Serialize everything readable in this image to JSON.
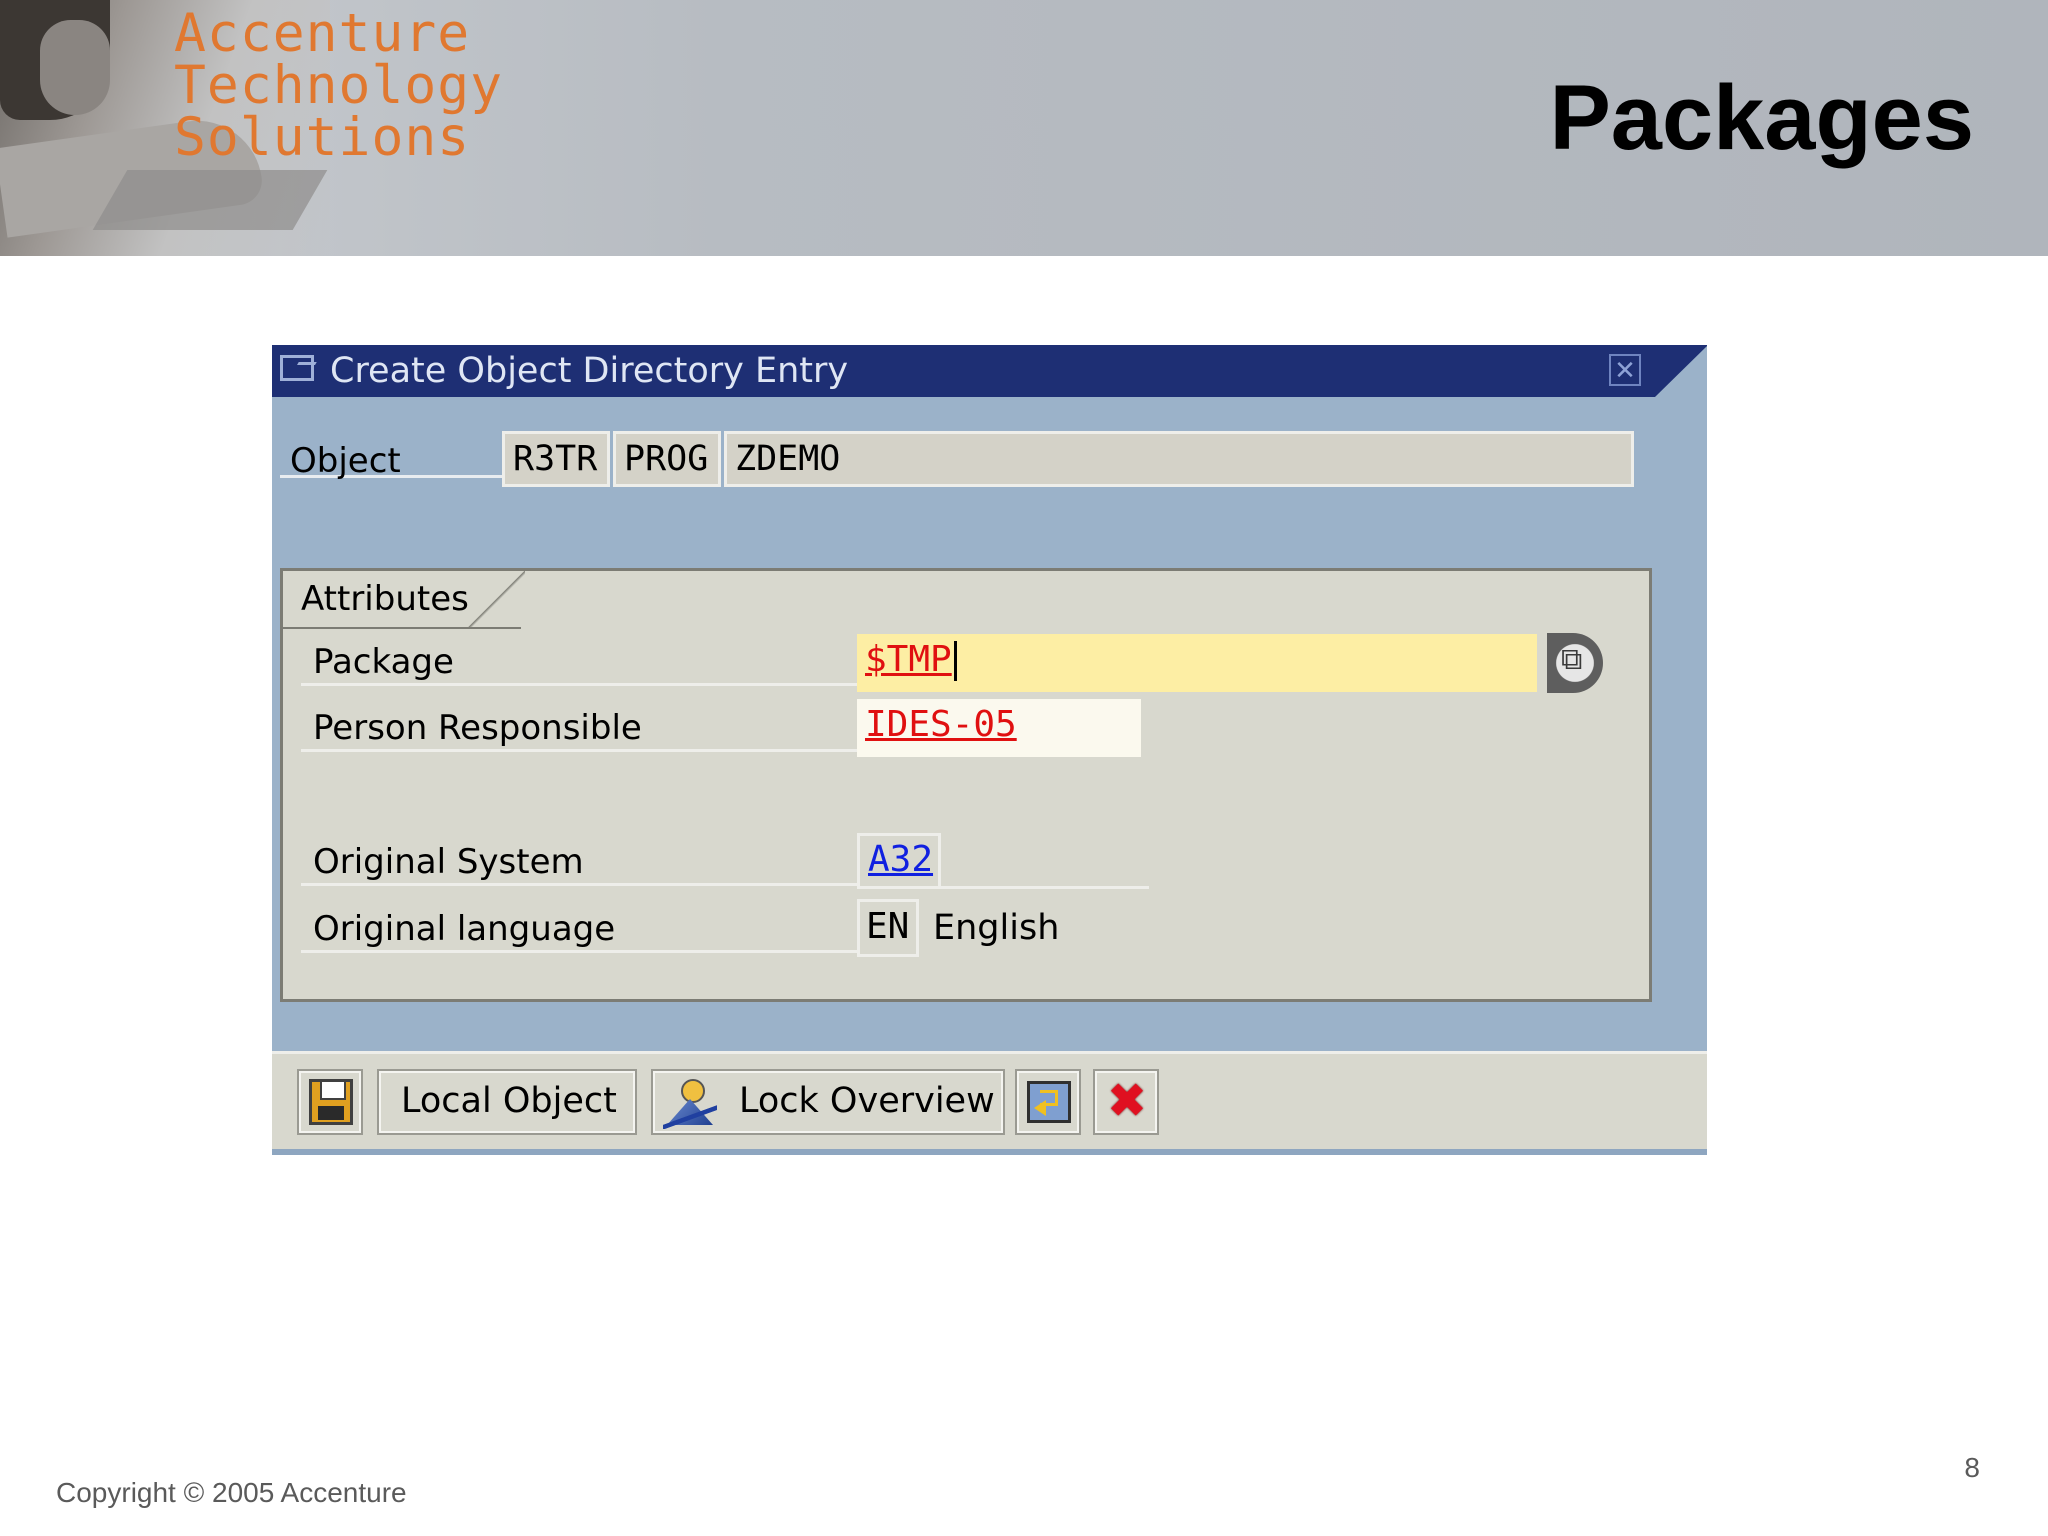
{
  "header": {
    "brand_lines": [
      "Accenture",
      "Technology",
      "Solutions"
    ],
    "slide_title": "Packages"
  },
  "dialog": {
    "title": "Create Object Directory Entry",
    "object": {
      "label": "Object",
      "pgmid": "R3TR",
      "type": "PROG",
      "name": "ZDEMO"
    },
    "attributes": {
      "group_title": "Attributes",
      "package_label": "Package",
      "package_value": "$TMP",
      "person_label": "Person Responsible",
      "person_value": "IDES-05",
      "system_label": "Original System",
      "system_value": "A32",
      "language_label": "Original language",
      "language_code": "EN",
      "language_text": "English"
    },
    "toolbar": {
      "local_object_label": "Local Object",
      "lock_overview_label": "Lock Overview"
    }
  },
  "footer": {
    "copyright": "Copyright © 2005 Accenture",
    "page_number": "8"
  },
  "icons": [
    "save-icon",
    "person-icon",
    "sort-icon",
    "cancel-icon",
    "close-icon",
    "possible-entries-icon"
  ],
  "colors": {
    "titlebar": "#1e2f74",
    "dialog_bg": "#9bb2c9",
    "brand": "#e07830",
    "required_field": "#fdeea4",
    "link_red": "#e01010",
    "link_blue": "#1020e0"
  }
}
